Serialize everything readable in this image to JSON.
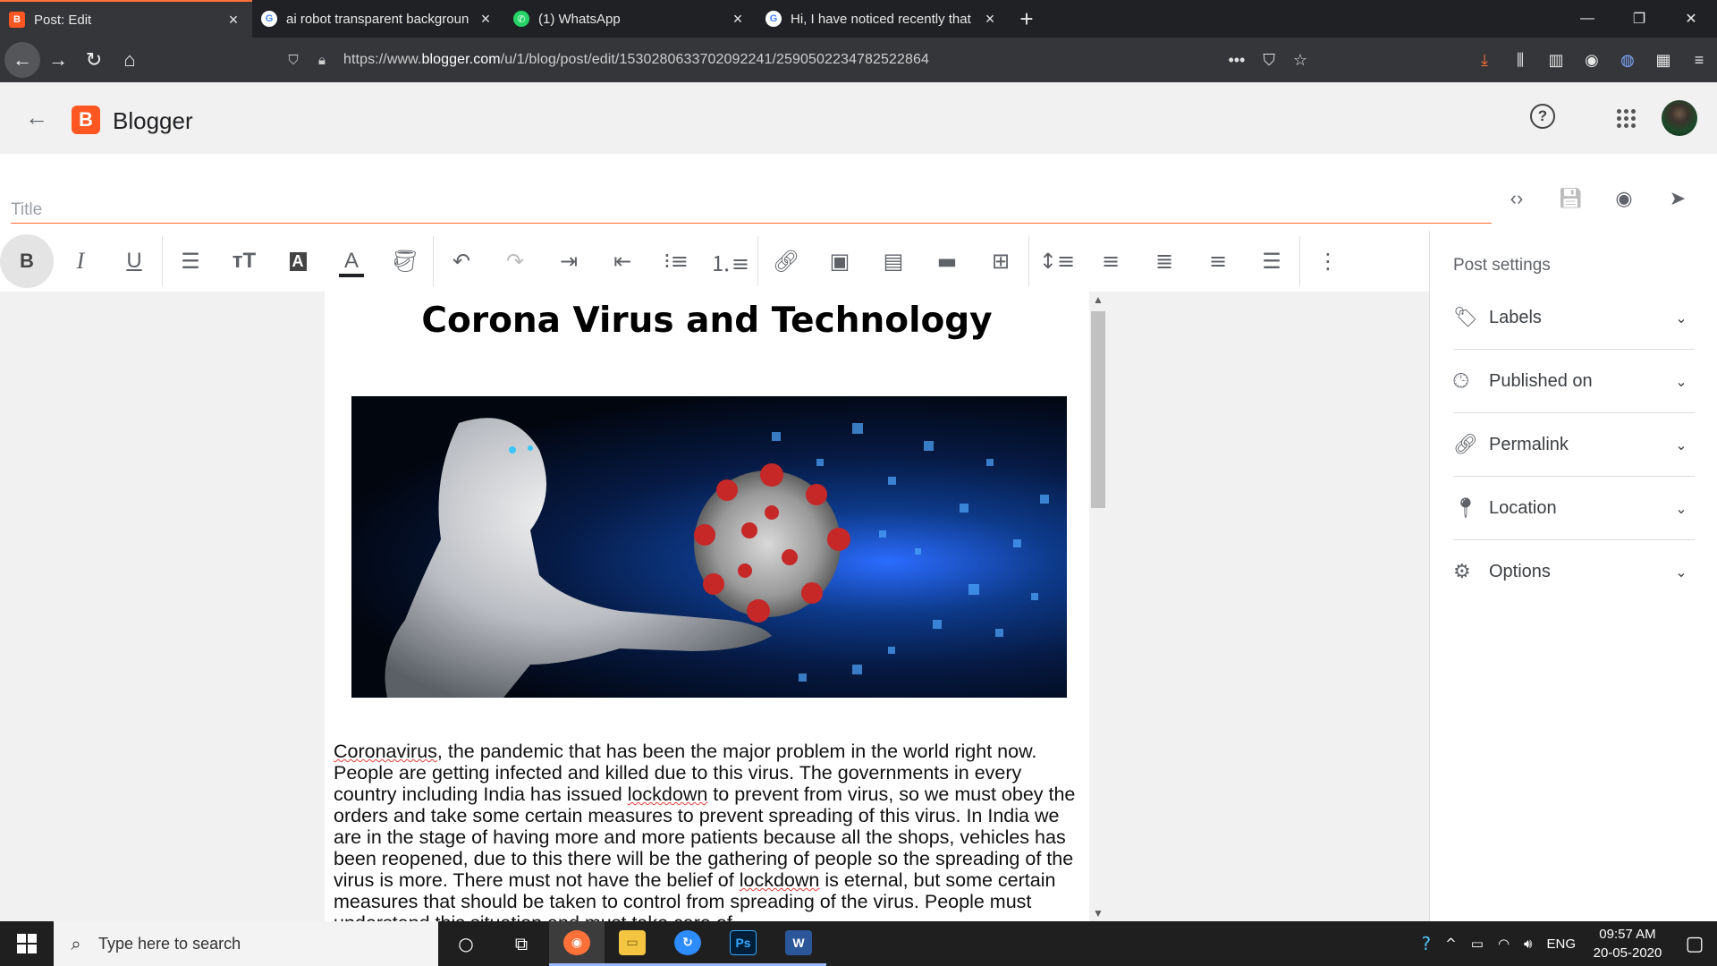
{
  "browser": {
    "tabs": [
      {
        "label": "Post: Edit",
        "favicon": "blogger-icon",
        "active": true
      },
      {
        "label": "ai robot transparent backgroun",
        "favicon": "google-icon",
        "active": false
      },
      {
        "label": "(1) WhatsApp",
        "favicon": "whatsapp-icon",
        "active": false
      },
      {
        "label": "Hi, I have noticed recently that",
        "favicon": "google-icon",
        "active": false
      }
    ],
    "url_prefix": "https://www.",
    "url_domain": "blogger.com",
    "url_path": "/u/1/blog/post/edit/1530280633702092241/2590502234782522864",
    "accent": "#ff7139"
  },
  "blogger": {
    "brand": "Blogger",
    "brand_color": "#ff5722",
    "help_label": "?"
  },
  "editor": {
    "title_placeholder": "Title",
    "post_title": "Corona Virus and Technology",
    "body_parts": [
      {
        "text": "Coronavirus",
        "spell": true
      },
      {
        "text": ", the pandemic that has been the major problem in the world right now. People are getting infected and killed due to this virus. The governments in every country including India has issued ",
        "spell": false
      },
      {
        "text": "lockdown",
        "spell": true
      },
      {
        "text": " to prevent from virus, so we must obey the orders and take some certain measures to prevent spreading of this virus. In India we are in the stage of having more and more patients because all the shops, vehicles has been reopened, due to this there will be the gathering of people so the spreading of the virus is more. There must not have the belief of ",
        "spell": false
      },
      {
        "text": "lockdown",
        "spell": true
      },
      {
        "text": " is eternal, but some certain measures that should be taken to control from spreading of the virus. People must understand this situation and must take care of",
        "spell": false
      }
    ]
  },
  "post_settings": {
    "heading": "Post settings",
    "items": [
      {
        "label": "Labels",
        "icon": "label-icon"
      },
      {
        "label": "Published on",
        "icon": "clock-icon"
      },
      {
        "label": "Permalink",
        "icon": "link-icon"
      },
      {
        "label": "Location",
        "icon": "location-pin-icon"
      },
      {
        "label": "Options",
        "icon": "gear-icon"
      }
    ]
  },
  "taskbar": {
    "search_placeholder": "Type here to search",
    "language": "ENG",
    "time": "09:57 AM",
    "date": "20-05-2020"
  }
}
